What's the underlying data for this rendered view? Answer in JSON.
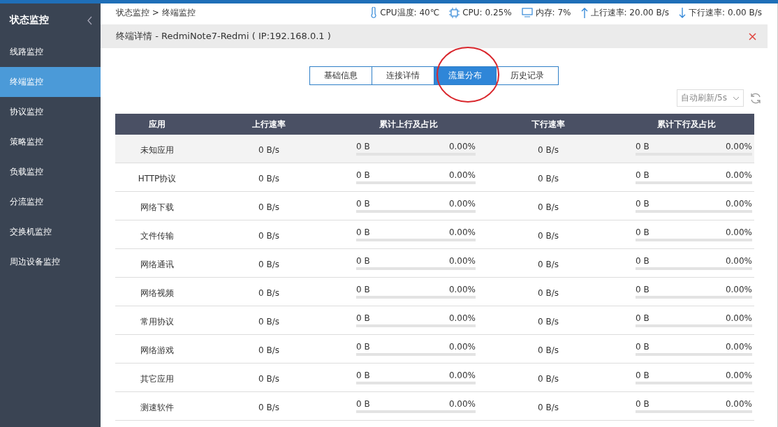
{
  "sidebar": {
    "title": "状态监控",
    "items": [
      {
        "label": "线路监控",
        "selected": false
      },
      {
        "label": "终端监控",
        "selected": true
      },
      {
        "label": "协议监控",
        "selected": false
      },
      {
        "label": "策略监控",
        "selected": false
      },
      {
        "label": "负载监控",
        "selected": false
      },
      {
        "label": "分流监控",
        "selected": false
      },
      {
        "label": "交换机监控",
        "selected": false
      },
      {
        "label": "周边设备监控",
        "selected": false
      }
    ]
  },
  "breadcrumb": [
    "状态监控",
    "终端监控"
  ],
  "breadcrumb_separator": ">",
  "stats": [
    {
      "kind": "temp",
      "text": "CPU温度: 40℃"
    },
    {
      "kind": "cpu",
      "text": "CPU: 0.25%"
    },
    {
      "kind": "memory",
      "text": "内存: 7%"
    },
    {
      "kind": "up",
      "text": "上行速率: 20.00 B/s"
    },
    {
      "kind": "down",
      "text": "下行速率: 0.00 B/s"
    }
  ],
  "panel": {
    "title": "终端详情 - RedmiNote7-Redmi ( IP:192.168.0.1 )"
  },
  "tabs": [
    {
      "label": "基础信息",
      "selected": false
    },
    {
      "label": "连接详情",
      "selected": false
    },
    {
      "label": "流量分布",
      "selected": true
    },
    {
      "label": "历史记录",
      "selected": false
    }
  ],
  "refresh": {
    "value": "自动刷新/5s"
  },
  "table": {
    "columns": [
      "应用",
      "上行速率",
      "累计上行及占比",
      "下行速率",
      "累计下行及占比"
    ],
    "rows": [
      {
        "selected": true,
        "app": "未知应用",
        "up": "0 B/s",
        "up_total": "0 B",
        "up_pct": "0.00%",
        "up_bar": {
          "level": 0
        },
        "down": "0 B/s",
        "down_total": "0 B",
        "down_pct": "0.00%",
        "down_bar": {
          "level": 0
        }
      },
      {
        "selected": false,
        "app": "HTTP协议",
        "up": "0 B/s",
        "up_total": "0 B",
        "up_pct": "0.00%",
        "up_bar": {
          "level": 0
        },
        "down": "0 B/s",
        "down_total": "0 B",
        "down_pct": "0.00%",
        "down_bar": {
          "level": 0
        }
      },
      {
        "selected": false,
        "app": "网络下载",
        "up": "0 B/s",
        "up_total": "0 B",
        "up_pct": "0.00%",
        "up_bar": {
          "level": 0
        },
        "down": "0 B/s",
        "down_total": "0 B",
        "down_pct": "0.00%",
        "down_bar": {
          "level": 0
        }
      },
      {
        "selected": false,
        "app": "文件传输",
        "up": "0 B/s",
        "up_total": "0 B",
        "up_pct": "0.00%",
        "up_bar": {
          "level": 0
        },
        "down": "0 B/s",
        "down_total": "0 B",
        "down_pct": "0.00%",
        "down_bar": {
          "level": 0
        }
      },
      {
        "selected": false,
        "app": "网络通讯",
        "up": "0 B/s",
        "up_total": "0 B",
        "up_pct": "0.00%",
        "up_bar": {
          "level": 0
        },
        "down": "0 B/s",
        "down_total": "0 B",
        "down_pct": "0.00%",
        "down_bar": {
          "level": 0
        }
      },
      {
        "selected": false,
        "app": "网络视频",
        "up": "0 B/s",
        "up_total": "0 B",
        "up_pct": "0.00%",
        "up_bar": {
          "level": 0
        },
        "down": "0 B/s",
        "down_total": "0 B",
        "down_pct": "0.00%",
        "down_bar": {
          "level": 0
        }
      },
      {
        "selected": false,
        "app": "常用协议",
        "up": "0 B/s",
        "up_total": "0 B",
        "up_pct": "0.00%",
        "up_bar": {
          "level": 0
        },
        "down": "0 B/s",
        "down_total": "0 B",
        "down_pct": "0.00%",
        "down_bar": {
          "level": 0
        }
      },
      {
        "selected": false,
        "app": "网络游戏",
        "up": "0 B/s",
        "up_total": "0 B",
        "up_pct": "0.00%",
        "up_bar": {
          "level": 0
        },
        "down": "0 B/s",
        "down_total": "0 B",
        "down_pct": "0.00%",
        "down_bar": {
          "level": 0
        }
      },
      {
        "selected": false,
        "app": "其它应用",
        "up": "0 B/s",
        "up_total": "0 B",
        "up_pct": "0.00%",
        "up_bar": {
          "level": 0
        },
        "down": "0 B/s",
        "down_total": "0 B",
        "down_pct": "0.00%",
        "down_bar": {
          "level": 0
        }
      },
      {
        "selected": false,
        "app": "测速软件",
        "up": "0 B/s",
        "up_total": "0 B",
        "up_pct": "0.00%",
        "up_bar": {
          "level": 0
        },
        "down": "0 B/s",
        "down_total": "0 B",
        "down_pct": "0.00%",
        "down_bar": {
          "level": 0
        }
      }
    ]
  }
}
